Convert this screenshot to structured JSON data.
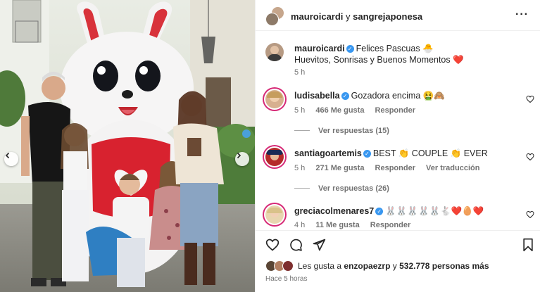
{
  "header": {
    "user1": "mauroicardi",
    "conj": "y",
    "user2": "sangrejaponesa",
    "more_icon": "more-horizontal-icon"
  },
  "caption": {
    "username": "mauroicardi",
    "line1": "Felices Pascuas 🐣",
    "line2": "Huevitos, Sonrisas y Buenos Momentos ❤️",
    "time": "5 h"
  },
  "comments": [
    {
      "username": "ludisabella",
      "verified": true,
      "text": "Gozadora encima 🤮🙈",
      "time": "5 h",
      "likes": "466 Me gusta",
      "reply": "Responder",
      "translate": "",
      "view_replies": "Ver respuestas (15)"
    },
    {
      "username": "santiagoartemis",
      "verified": true,
      "text": "BEST 👏 COUPLE 👏 EVER",
      "time": "5 h",
      "likes": "271 Me gusta",
      "reply": "Responder",
      "translate": "Ver traducción",
      "view_replies": "Ver respuestas (26)"
    },
    {
      "username": "greciacolmenares7",
      "verified": true,
      "text": "🐰🐰🐰🐰🐰🐇❤️🥚❤️",
      "time": "4 h",
      "likes": "11 Me gusta",
      "reply": "Responder",
      "translate": "",
      "view_replies": ""
    }
  ],
  "footer": {
    "likes_prefix": "Les gusta a",
    "likes_user": "enzopaezrp",
    "likes_joiner": "y",
    "likes_count": "532.778 personas más",
    "time": "Hace 5 horas"
  },
  "colors": {
    "verified": "#3897f0",
    "story_ring": "#d62976",
    "muted_text": "#737373",
    "border": "#efefef"
  }
}
